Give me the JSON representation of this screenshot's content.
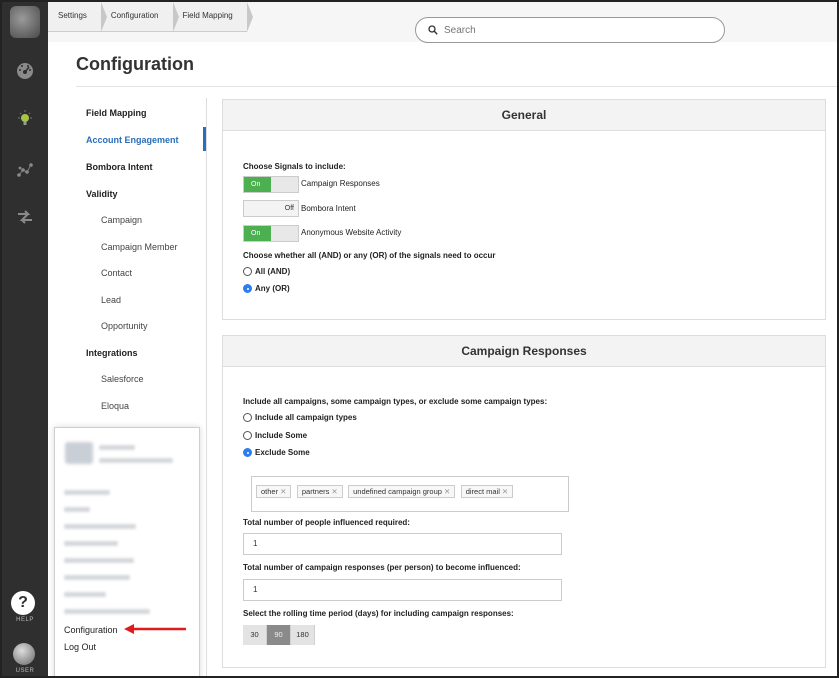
{
  "breadcrumbs": [
    "Settings",
    "Configuration",
    "Field Mapping"
  ],
  "search": {
    "placeholder": "Search"
  },
  "page_title": "Configuration",
  "rail": {
    "help_label": "HELP",
    "user_label": "USER"
  },
  "subnav": {
    "items": [
      {
        "label": "Field Mapping"
      },
      {
        "label": "Account Engagement"
      },
      {
        "label": "Bombora Intent"
      },
      {
        "label": "Validity"
      },
      {
        "label": "Campaign"
      },
      {
        "label": "Campaign Member"
      },
      {
        "label": "Contact"
      },
      {
        "label": "Lead"
      },
      {
        "label": "Opportunity"
      },
      {
        "label": "Integrations"
      },
      {
        "label": "Salesforce"
      },
      {
        "label": "Eloqua"
      }
    ]
  },
  "user_menu": {
    "configuration": "Configuration",
    "logout": "Log Out"
  },
  "general": {
    "title": "General",
    "signals_label": "Choose Signals to include:",
    "signals": [
      {
        "label": "Campaign Responses",
        "state": "On"
      },
      {
        "label": "Bombora Intent",
        "state": "Off"
      },
      {
        "label": "Anonymous Website Activity",
        "state": "On"
      }
    ],
    "logic_label": "Choose whether all (AND) or any (OR) of the signals need to occur",
    "logic_options": [
      "All (AND)",
      "Any (OR)"
    ],
    "logic_selected": "Any (OR)"
  },
  "campaign_responses": {
    "title": "Campaign Responses",
    "include_label": "Include all campaigns, some campaign types, or exclude some campaign types:",
    "include_options": [
      "Include all campaign types",
      "Include Some",
      "Exclude Some"
    ],
    "include_selected": "Exclude Some",
    "tags": [
      "other",
      "partners",
      "undefined campaign group",
      "direct mail"
    ],
    "people_label": "Total number of people influenced required:",
    "people_value": "1",
    "responses_label": "Total number of campaign responses (per person) to become influenced:",
    "responses_value": "1",
    "period_label": "Select the rolling time period (days) for including campaign responses:",
    "period_options": [
      "30",
      "90",
      "180"
    ],
    "period_selected": "90"
  }
}
